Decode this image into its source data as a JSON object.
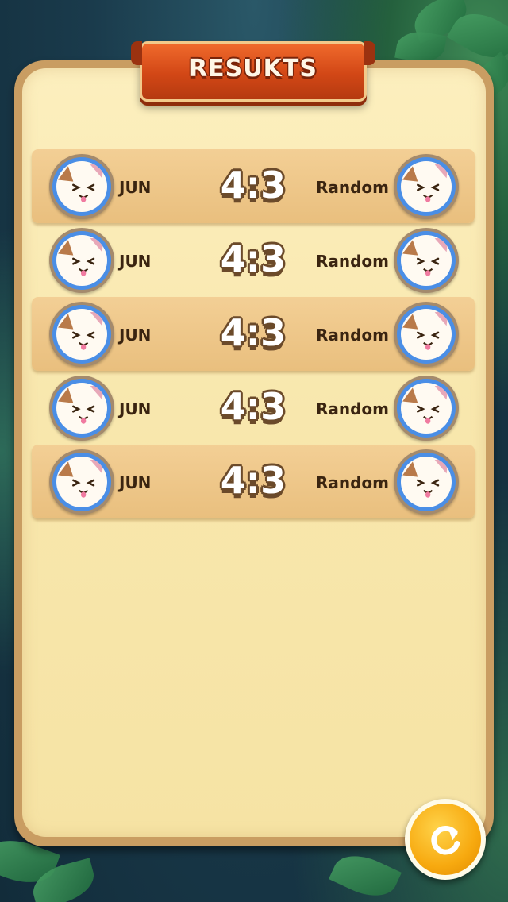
{
  "title": "RESUKTS",
  "results": [
    {
      "player_name": "JUN",
      "score": "4:3",
      "opponent_name": "Random"
    },
    {
      "player_name": "JUN",
      "score": "4:3",
      "opponent_name": "Random"
    },
    {
      "player_name": "JUN",
      "score": "4:3",
      "opponent_name": "Random"
    },
    {
      "player_name": "JUN",
      "score": "4:3",
      "opponent_name": "Random"
    },
    {
      "player_name": "JUN",
      "score": "4:3",
      "opponent_name": "Random"
    }
  ],
  "icons": {
    "avatar": "cat-avatar-icon",
    "refresh": "refresh-icon"
  },
  "colors": {
    "title_ribbon": "#d24716",
    "panel_bg": "#f8e7ad",
    "row_shade": "#e9bf7e",
    "avatar_ring": "#4a8ee6",
    "refresh_button": "#f7a90f"
  }
}
